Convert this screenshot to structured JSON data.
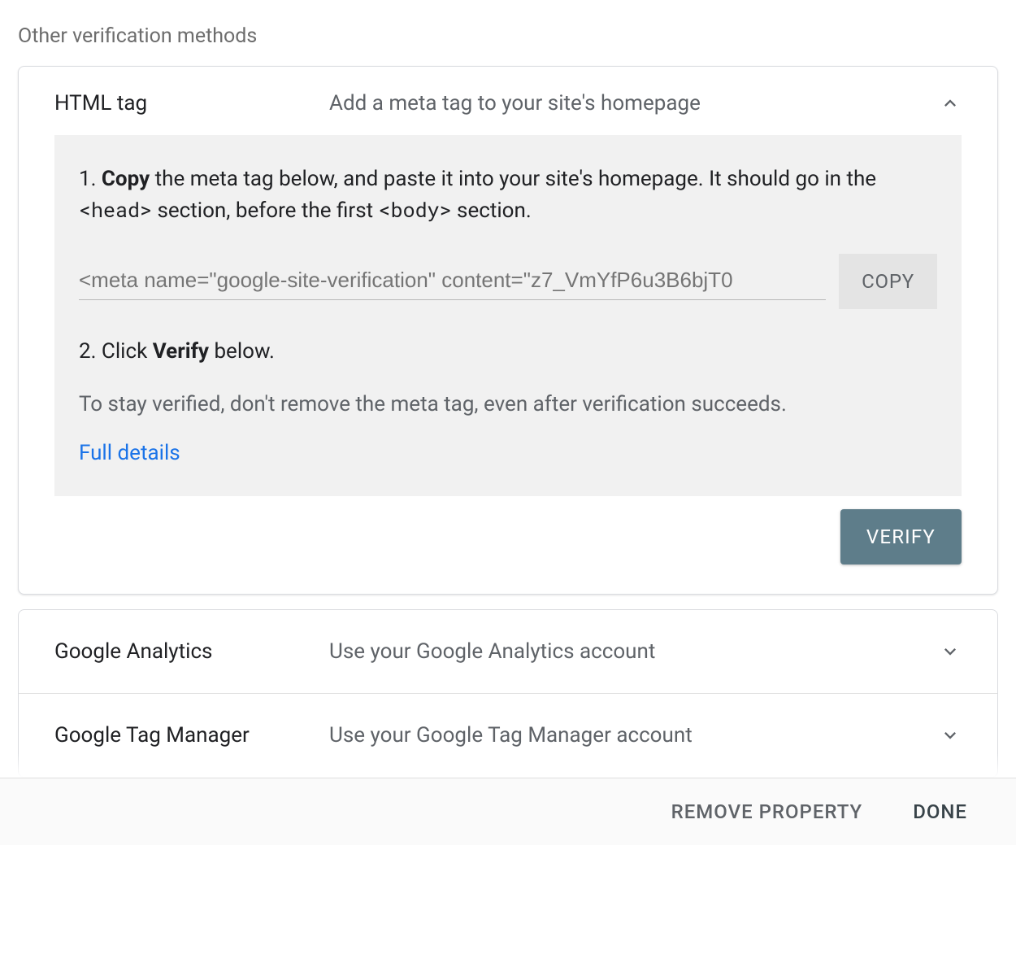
{
  "section_title": "Other verification methods",
  "html_tag": {
    "title": "HTML tag",
    "subtitle": "Add a meta tag to your site's homepage",
    "step1_prefix": "1. ",
    "step1_bold": "Copy",
    "step1_mid1": " the meta tag below, and paste it into your site's homepage. It should go in the ",
    "step1_code1": "<head>",
    "step1_mid2": " section, before the first ",
    "step1_code2": "<body>",
    "step1_end": " section.",
    "meta_tag_value": "<meta name=\"google-site-verification\" content=\"z7_VmYfP6u3B6bjT0",
    "copy_label": "COPY",
    "step2_prefix": "2. Click ",
    "step2_bold": "Verify",
    "step2_end": " below.",
    "note": "To stay verified, don't remove the meta tag, even after verification succeeds.",
    "full_details": "Full details",
    "verify_label": "VERIFY"
  },
  "methods": [
    {
      "title": "Google Analytics",
      "subtitle": "Use your Google Analytics account"
    },
    {
      "title": "Google Tag Manager",
      "subtitle": "Use your Google Tag Manager account"
    }
  ],
  "footer": {
    "remove": "REMOVE PROPERTY",
    "done": "DONE"
  }
}
